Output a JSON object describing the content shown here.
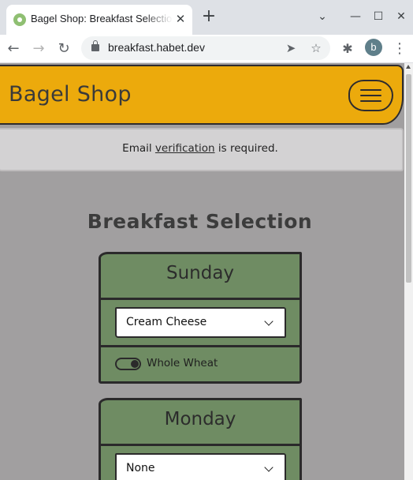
{
  "browser": {
    "tab_title": "Bagel Shop: Breakfast Selection",
    "url": "breakfast.habet.dev",
    "profile_initial": "b"
  },
  "site": {
    "brand": "Bagel Shop",
    "alert": {
      "prefix": "Email ",
      "link": "verification",
      "suffix": " is required."
    },
    "title": "Breakfast Selection"
  },
  "days": [
    {
      "name": "Sunday",
      "selection": "Cream Cheese",
      "toggle_label": "Whole Wheat",
      "toggle_on": true
    },
    {
      "name": "Monday",
      "selection": "None"
    }
  ],
  "colors": {
    "header": "#ecaa0c",
    "card": "#6f8c63",
    "background": "#a19fa0"
  }
}
